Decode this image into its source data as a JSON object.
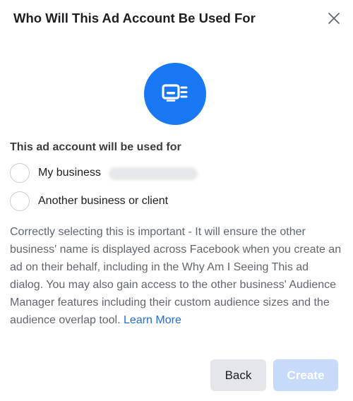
{
  "dialog": {
    "title": "Who Will This Ad Account Be Used For",
    "close_icon": "close-icon",
    "hero_icon": "ad-account-icon"
  },
  "usage": {
    "label": "This ad account will be used for",
    "options": [
      {
        "label": "My business",
        "selected": false,
        "suffix_redacted": true
      },
      {
        "label": "Another business or client",
        "selected": false
      }
    ]
  },
  "description": {
    "text": "Correctly selecting this is important - It will ensure the other business' name is displayed across Facebook when you create an ad on their behalf, including in the Why Am I Seeing This ad dialog. You may also gain access to the other business' Audience Manager features including their custom audience sizes and the audience overlap tool.",
    "link_text": "Learn More"
  },
  "footer": {
    "back_label": "Back",
    "create_label": "Create",
    "create_enabled": false
  },
  "colors": {
    "accent": "#1877f2",
    "link": "#216fdb",
    "disabled_button": "#c6dbfa",
    "secondary_button": "#e4e6eb"
  }
}
